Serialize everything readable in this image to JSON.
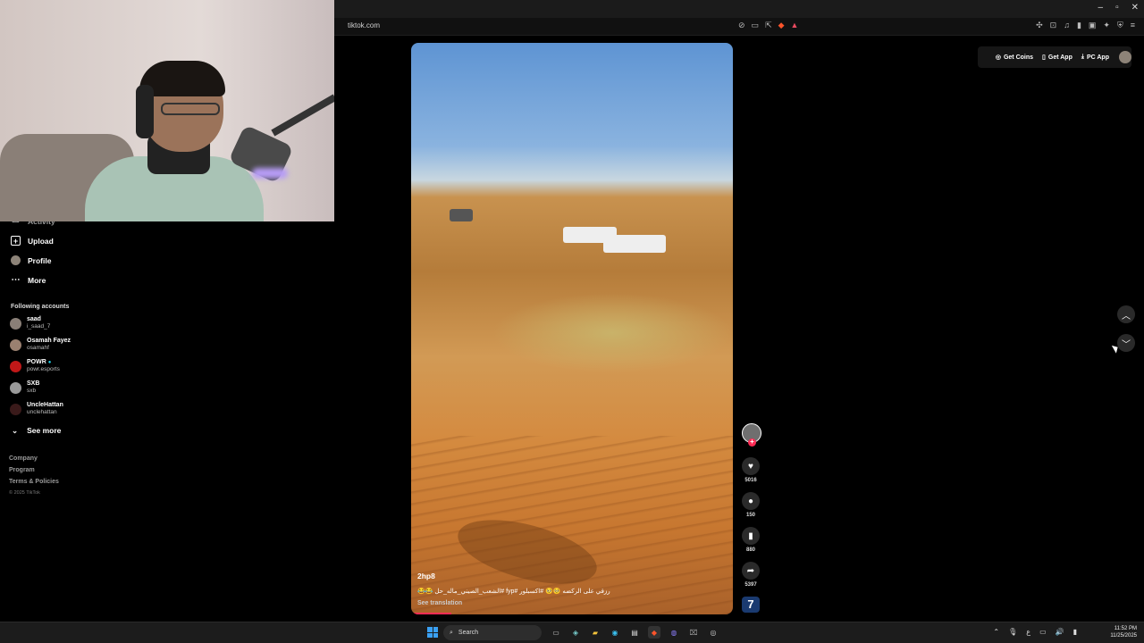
{
  "browser": {
    "url": "tiktok.com",
    "window_controls": [
      "–",
      "▫",
      "✕"
    ]
  },
  "sidebar": {
    "activity_label": "Activity",
    "nav": [
      {
        "label": "Upload",
        "icon": "plus-box-icon"
      },
      {
        "label": "Profile",
        "icon": "avatar"
      },
      {
        "label": "More",
        "icon": "more-dots-icon"
      }
    ],
    "following_title": "Following accounts",
    "accounts": [
      {
        "name": "saad",
        "handle": "i_saad_7",
        "color": "#8a7f77"
      },
      {
        "name": "Osamah Fayez",
        "handle": "osamahf",
        "color": "#9a8070"
      },
      {
        "name": "POWR",
        "handle": "powr.esports",
        "color": "#c01818",
        "verified": true
      },
      {
        "name": "SXB",
        "handle": "sxb",
        "color": "#9a9a9a"
      },
      {
        "name": "UncleHattan",
        "handle": "unclehattan",
        "color": "#3a1a1a"
      }
    ],
    "see_more": "See more",
    "footer": [
      "Company",
      "Program",
      "Terms & Policies"
    ],
    "copyright": "© 2025 TikTok"
  },
  "video": {
    "author": "2hp8",
    "caption": "رزقي على الركضه 🥺🥺 #اكسبلور #fyp #الشعب_الصيني_ماله_حل 😂😂",
    "see_translation": "See translation",
    "progress_fraction": 0.125
  },
  "actions": {
    "likes": "5016",
    "comments": "150",
    "saves": "880",
    "shares": "5397",
    "disc_label": "7"
  },
  "top_right": {
    "get_coins": "Get Coins",
    "get_app": "Get App",
    "pc_app": "PC App"
  },
  "taskbar": {
    "search_placeholder": "Search",
    "time": "11:52 PM",
    "date": "11/25/2025"
  }
}
